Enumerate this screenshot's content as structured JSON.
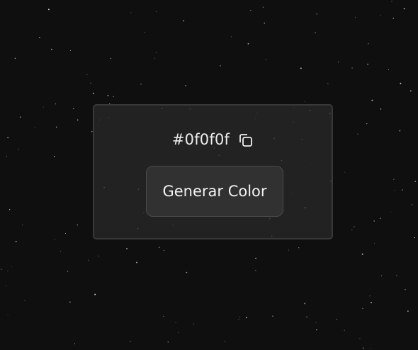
{
  "color_display": {
    "hex_value": "#0f0f0f",
    "copy_icon": "copy-icon"
  },
  "actions": {
    "generate_label": "Generar Color"
  },
  "theme": {
    "background": "#0f0f0f",
    "card_background": "#242424",
    "card_border": "#383838",
    "button_background": "#313131",
    "text_color": "#ececec"
  }
}
